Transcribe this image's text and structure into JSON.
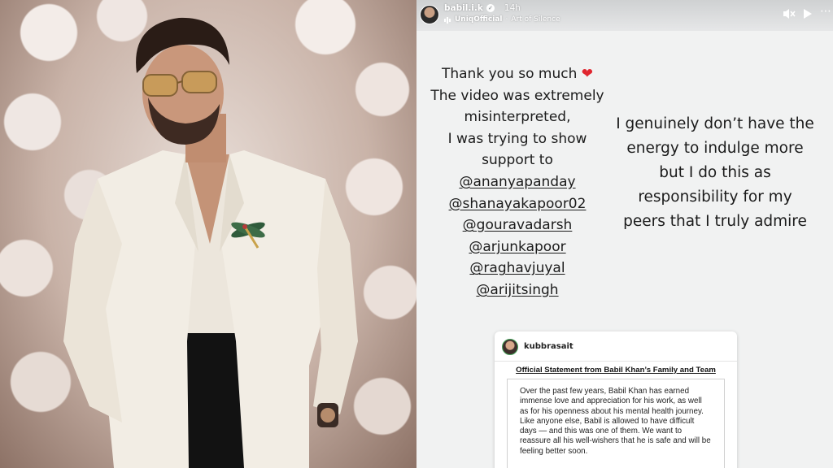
{
  "story": {
    "username": "babil.i.k",
    "time": "14h",
    "music_artist": "UniqOfficial",
    "music_track": "Art of Silence",
    "text_left": {
      "line1": "Thank you so much",
      "line2": "The  video was extremely",
      "line3": "misinterpreted,",
      "line4": "I was trying to show",
      "line5": "support to",
      "mentions": [
        "@ananyapanday",
        "@shanayakapoor02",
        "@gouravadarsh",
        "@arjunkapoor",
        "@raghavjuyal",
        "@arijitsingh"
      ]
    },
    "text_right": {
      "line1": "I genuinely don’t have the",
      "line2": "energy to indulge more",
      "line3": "but I do this as",
      "line4": "responsibility for my",
      "line5": "peers that I truly admire"
    }
  },
  "post": {
    "username": "kubbrasait",
    "title": "Official Statement from Babil Khan’s Family and Team",
    "body": "Over the past few years, Babil Khan has earned immense love and appreciation for his work, as well as for his openness about his mental health journey. Like anyone else, Babil is allowed to have difficult days — and this was one of them. We want to reassure all his well-wishers that he is safe and will be feeling better soon."
  },
  "icons": {
    "verified": "verified-badge-icon",
    "music": "music-bars-icon",
    "mute": "speaker-muted-icon",
    "play": "play-icon",
    "more": "more-options-icon"
  },
  "colors": {
    "heart": "#e0262f",
    "story_background": "#f1f2f2",
    "blazer": "#f2ede4"
  }
}
